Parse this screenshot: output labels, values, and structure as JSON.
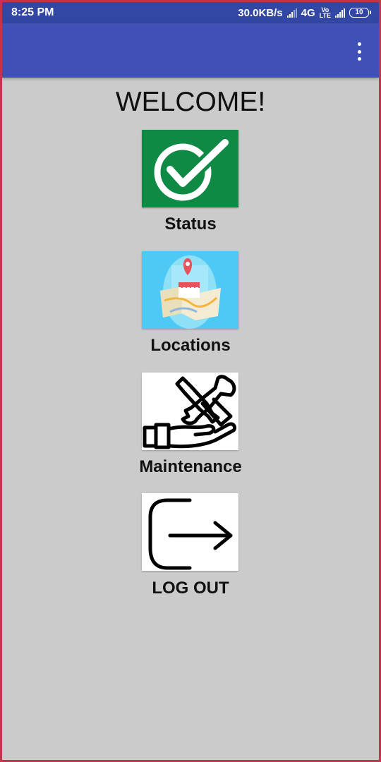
{
  "status_bar": {
    "time": "8:25 PM",
    "speed": "30.0KB/s",
    "network": "4G",
    "volte_top": "Vo",
    "volte_bottom": "LTE",
    "battery": "10"
  },
  "app_bar": {
    "menu_icon": "more-vert-icon",
    "background": "#3f51b5"
  },
  "main": {
    "title": "WELCOME!",
    "items": [
      {
        "label": "Status",
        "icon": "checkmark-icon"
      },
      {
        "label": "Locations",
        "icon": "map-location-icon"
      },
      {
        "label": "Maintenance",
        "icon": "tools-hand-icon"
      },
      {
        "label": "LOG OUT",
        "icon": "logout-icon"
      }
    ]
  },
  "colors": {
    "status_bar": "#3246a3",
    "background": "#cbcbcb",
    "status_green": "#0e8a44",
    "location_blue": "#4ec9f5"
  }
}
